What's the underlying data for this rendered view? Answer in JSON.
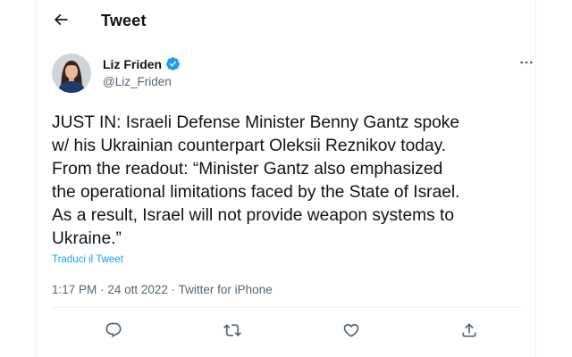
{
  "header": {
    "title": "Tweet",
    "back_icon": "arrow-left-icon"
  },
  "author": {
    "name": "Liz Friden",
    "handle": "@Liz_Friden",
    "verified_icon": "verified-badge-icon",
    "verified_color": "#1d9bf0"
  },
  "tweet": {
    "text": "JUST IN: Israeli Defense Minister Benny Gantz spoke\nw/ his Ukrainian counterpart Oleksii Reznikov today.\nFrom the readout: “Minister Gantz also emphasized\nthe operational limitations faced by the State of Israel.\nAs a result, Israel will not provide weapon systems to\nUkraine.”",
    "translate_label": "Traduci il Tweet",
    "time": "1:17 PM",
    "date": "24 ott 2022",
    "separator": "·",
    "source": "Twitter for iPhone"
  },
  "actions": [
    {
      "icon": "reply-icon"
    },
    {
      "icon": "retweet-icon"
    },
    {
      "icon": "like-icon"
    },
    {
      "icon": "share-icon"
    }
  ],
  "colors": {
    "accent": "#1d9bf0",
    "text": "#0f1419",
    "secondary": "#536471",
    "border": "#eff3f4"
  }
}
